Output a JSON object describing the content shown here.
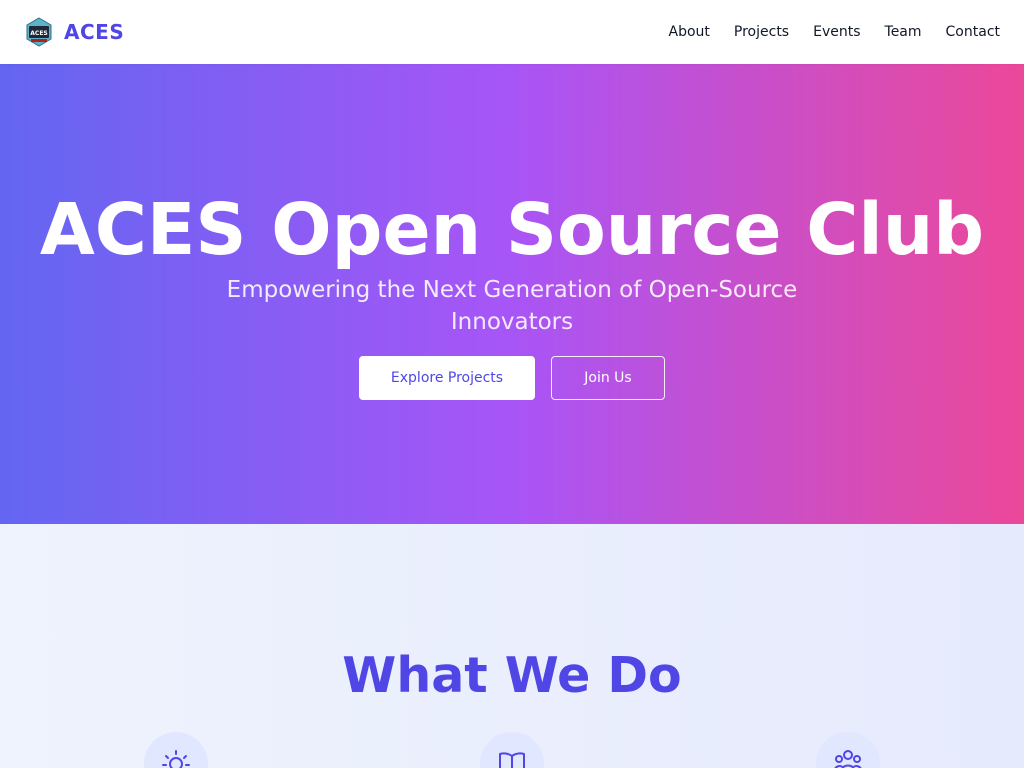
{
  "navbar": {
    "brand": "ACES",
    "logo_text": "ACES",
    "links": [
      "About",
      "Projects",
      "Events",
      "Team",
      "Contact"
    ]
  },
  "hero": {
    "title": "ACES Open Source Club",
    "subtitle": "Empowering the Next Generation of Open-Source Innovators",
    "primary_button": "Explore Projects",
    "secondary_button": "Join Us"
  },
  "what_we_do": {
    "title": "What We Do",
    "features": [
      {
        "icon": "lightbulb-icon"
      },
      {
        "icon": "book-icon"
      },
      {
        "icon": "community-icon"
      }
    ]
  },
  "colors": {
    "accent": "#4f46e5",
    "hero_gradient_start": "#6366f1",
    "hero_gradient_mid": "#a855f7",
    "hero_gradient_end": "#ec4899",
    "section_background": "#eef3fd",
    "icon_background": "#e0e7ff"
  }
}
